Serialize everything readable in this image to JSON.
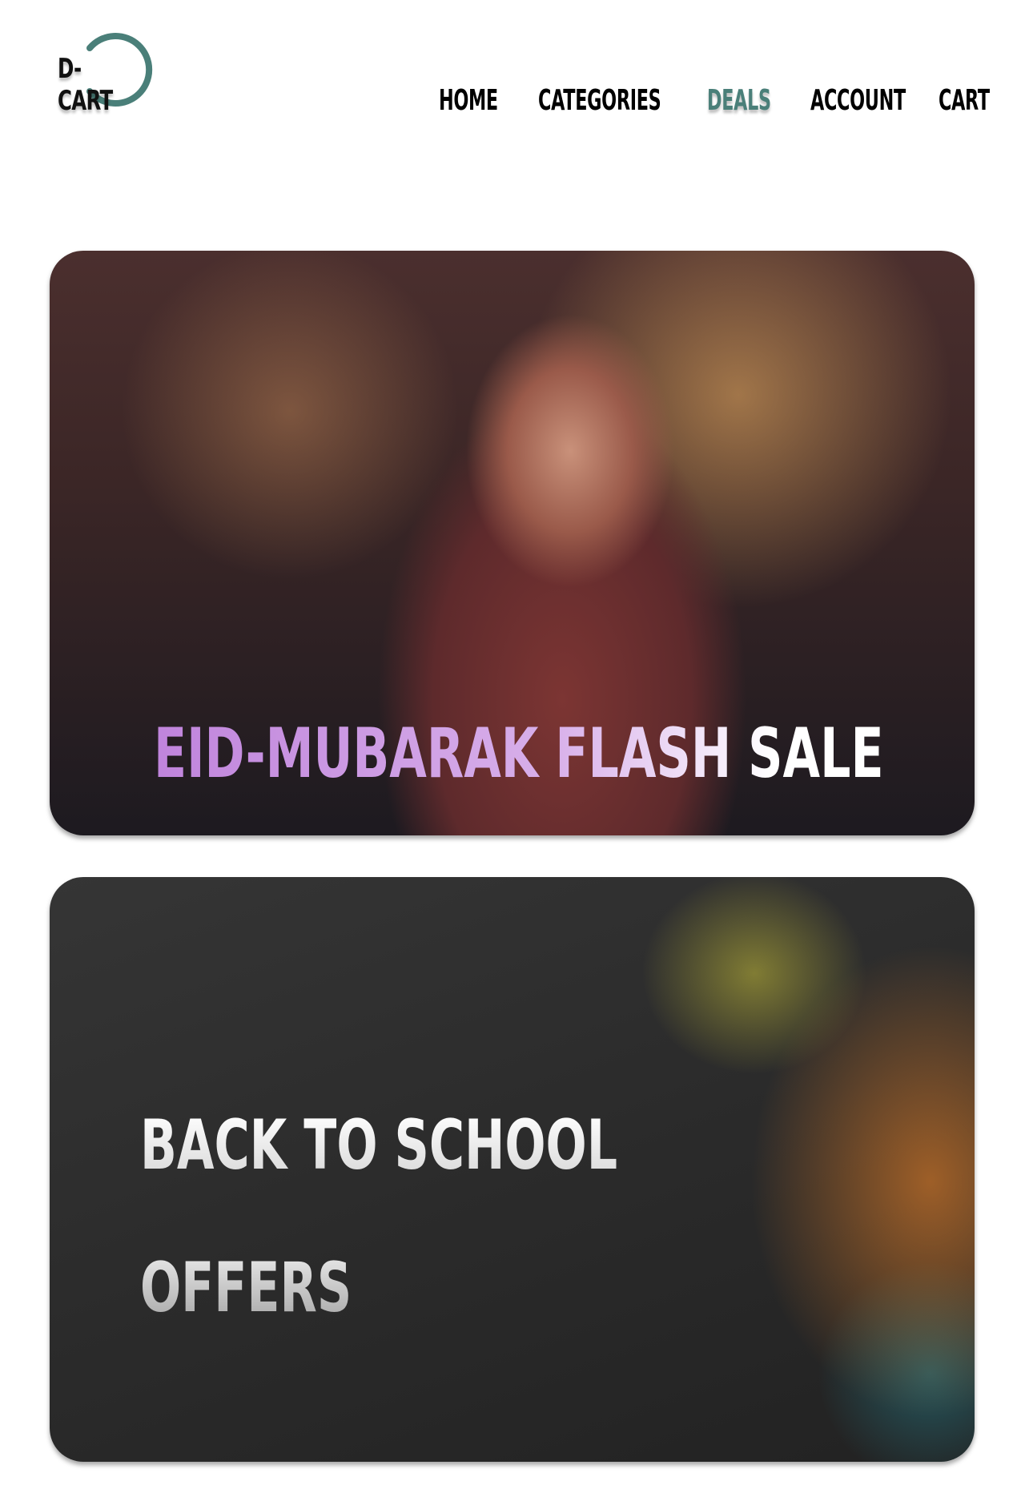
{
  "logo": {
    "text": "D-CART",
    "ring_color": "#4a7f79"
  },
  "nav": {
    "items": [
      {
        "label": "HOME",
        "active": false
      },
      {
        "label": "CATEGORIES",
        "active": false
      },
      {
        "label": "DEALS",
        "active": true
      },
      {
        "label": "ACCOUNT",
        "active": false
      },
      {
        "label": "CART",
        "active": false
      }
    ],
    "active_color": "#4a7f79"
  },
  "deals": [
    {
      "title": "EID-MUBARAK FLASH SALE"
    },
    {
      "title_line1": "BACK TO SCHOOL",
      "title_line2": "OFFERS"
    }
  ]
}
